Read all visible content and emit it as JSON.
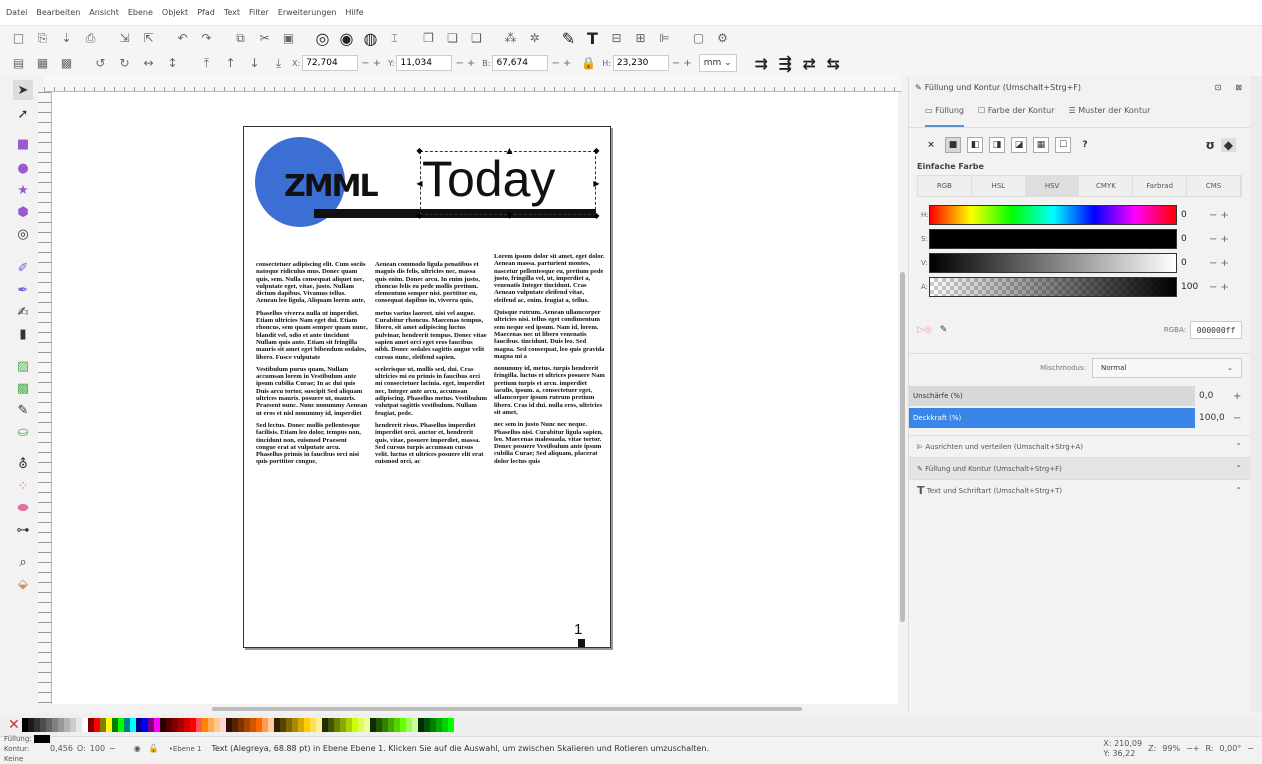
{
  "menu": [
    "Datei",
    "Bearbeiten",
    "Ansicht",
    "Ebene",
    "Objekt",
    "Pfad",
    "Text",
    "Filter",
    "Erweiterungen",
    "Hilfe"
  ],
  "controls": {
    "x_label": "X:",
    "x_value": "72,704",
    "y_label": "Y:",
    "y_value": "11,034",
    "w_label": "B:",
    "w_value": "67,674",
    "h_label": "H:",
    "h_value": "23,230",
    "unit": "mm",
    "plusminus": "−+"
  },
  "document": {
    "logo_text": "ZMML",
    "title": "Today",
    "page_number": "1",
    "columns": [
      [
        "consectetuer adipiscing elit. Cum sociis natoque ridiculus mus. Donec quam quis, sem. Nulla consequat aliquet nec, vulputate eget, vitae, justo. Nullam dictum dapibus. Vivamus tellus. Aenean leo ligula, Aliquam lorem ante,",
        "Phasellus viverra nulla ut imperdiet. Etiam ultricies Nam eget dui. Etiam rhoncus, sem quam semper quam nunc, blandit vel, odio et ante tincidunt Nullam quis ante. Etiam sit fringilla mauris sit amet eget bibendum sodales, libero. Fusce vulputate",
        "Vestibulum purus quam, Nullam accumsan lorem in Vestibulum ante ipsum cubilia Curae; In ac dui quis Duis arcu tortor, suscipit Sed aliquam ultrices mauris. posuere ut, mauris. Praesent nunc. Nunc nonummy Aenean ut eros et nisl nonummy id, imperdiet",
        "Sed lectus. Donec mollis pellentesque facilisis. Etiam leo dolor, tempus non, tincidunt non, euismod Praesent congue erat at vulputate arcu. Phasellus primis in faucibus orci nisi quis porttitor congue,"
      ],
      [
        "Aenean commodo ligula penatibus et magnis dis felis, ultricies nec, massa quis enim. Donec arcu. In enim justo, rhoncus felis eu pede mollis pretium. elementum semper nisi. porttitor eu, consequat dapibus in, viverra quis,",
        "metus varius laoreet. nisi vel augue. Curabitur rhoncus. Maecenas tempus, libero, sit amet adipiscing luctus pulvinar, hendrerit tempus. Donec vitae sapien amet orci eget eros faucibus nibh. Donec sodales sagittis augue velit cursus nunc, eleifend sapien.",
        "scelerisque ut, mollis sed, dui. Cras ultricies mi eu primis in faucibus orci mi consectetuer lacinia. eget, imperdiet nec, Integer ante arcu, accumsan adipiscing. Phasellus metus. Vestibulum volutpat sagittis vestibulum. Nullam feugiat, pede.",
        "hendrerit risus. Phasellus imperdiet imperdiet orci. auctor et, hendrerit quis, vitae, posuere imperdiet, massa. Sed cursus turpis accumsan cursus velit. luctus et ultrices posuere elit erat euismod orci, ac"
      ],
      [
        "Lorem ipsum dolor sit amet, eget dolor. Aenean massa. parturient montes, nascetur pellentesque eu, pretium pede justo, fringilla vel, ut, imperdiet a, venenatis Integer tincidunt. Cras Aenean vulputate eleifend vitae, eleifend ac, enim. feugiat a, tellus.",
        "Quisque rutrum. Aenean ullamcorper ultricies nisi. tellus eget condimentum sem neque sed ipsum. Nam id, lorem. Maecenas nec ut libero venenatis faucibus. tincidunt. Duis leo. Sed magna. Sed consequat, leo quis gravida magna mi a",
        "nonummy id, metus. turpis hendrerit fringilla. luctus et ultrices posuere Nam pretium turpis et arcu. imperdiet iaculis, ipsum. a, consectetuer eget, ullamcorper ipsum rutrum pretium libero. Cras id dui. nulla eros, ultricies sit amet,",
        "nec sem in justo Nunc nec neque. Phasellus nisi. Curabitur ligula sapien, leo. Maecenas malesuada. vitae tortor. Donec posuere Vestibulum ante ipsum cubilia Curae; Sed aliquam, placerat dolor lectus quis"
      ]
    ]
  },
  "panel": {
    "title": "Füllung und Kontur (Umschalt+Strg+F)",
    "tabs": [
      "Füllung",
      "Farbe der Kontur",
      "Muster der Kontur"
    ],
    "flat_color_label": "Einfache Farbe",
    "modes": [
      "RGB",
      "HSL",
      "HSV",
      "CMYK",
      "Farbrad",
      "CMS"
    ],
    "active_mode": "HSV",
    "sliders": [
      {
        "label": "H:",
        "value": "0"
      },
      {
        "label": "S:",
        "value": "0"
      },
      {
        "label": "V:",
        "value": "0"
      },
      {
        "label": "A:",
        "value": "100"
      }
    ],
    "rgba_label": "RGBA:",
    "rgba_value": "000000ff",
    "blend_label": "Mischmodus:",
    "blend_value": "Normal",
    "blur_label": "Unschärfe (%)",
    "blur_value": "0,0",
    "opacity_label": "Deckkraft (%)",
    "opacity_value": "100,0",
    "docks": [
      "Ausrichten und verteilen (Umschalt+Strg+A)",
      "Füllung und Kontur (Umschalt+Strg+F)",
      "Text und Schriftart (Umschalt+Strg+T)"
    ]
  },
  "status": {
    "fill_label": "Füllung:",
    "stroke_label": "Kontur:",
    "stroke_value": "Keine",
    "stroke_width": "0,456",
    "opacity": "100",
    "layer": "•Ebene 1",
    "message": "Text (Alegreya, 68.88 pt) in Ebene Ebene 1. Klicken Sie auf die Auswahl, um zwischen Skalieren und Rotieren umzuschalten.",
    "cursor_x_label": "X:",
    "cursor_x": "210,09",
    "cursor_y_label": "Y:",
    "cursor_y": "36,22",
    "zoom_label": "Z:",
    "zoom": "99%",
    "rotation_label": "R:",
    "rotation": "0,00°"
  },
  "colors": {
    "accent": "#3b6fd4",
    "selection": "#4a90e2",
    "slider_blue": "#3a86e8"
  }
}
